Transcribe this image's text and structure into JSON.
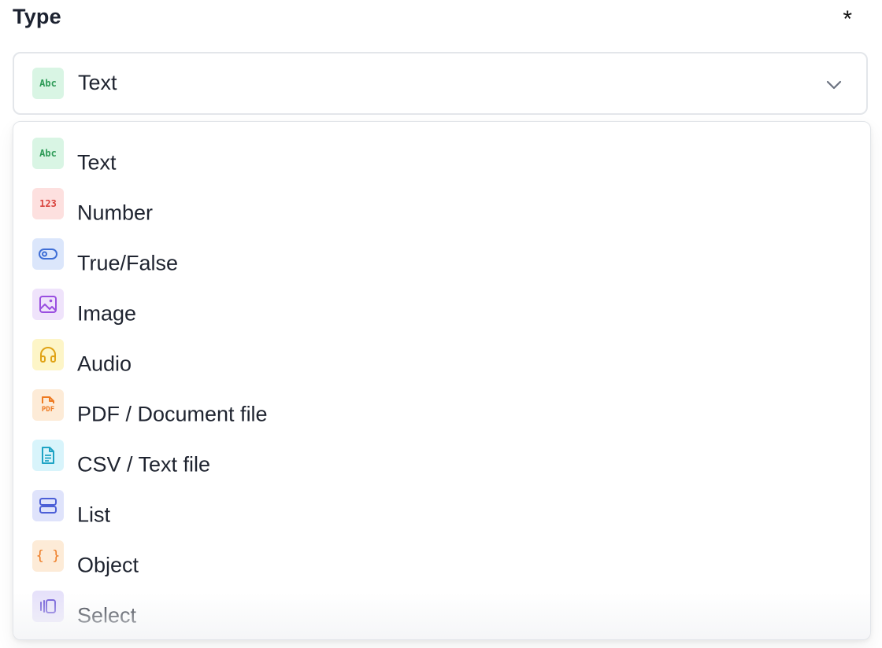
{
  "field": {
    "label": "Type",
    "required_mark": "*"
  },
  "select": {
    "selected_label": "Text",
    "selected_icon": "text-abc-icon",
    "selected_icon_text": "Abc"
  },
  "options": [
    {
      "label": "Text",
      "icon": "text-abc-icon",
      "icon_text": "Abc",
      "bg": "#d9f5e4",
      "fg": "#2e9b57"
    },
    {
      "label": "Number",
      "icon": "number-123-icon",
      "icon_text": "123",
      "bg": "#fde0df",
      "fg": "#d9443e"
    },
    {
      "label": "True/False",
      "icon": "toggle-icon",
      "bg": "#dbe6fb",
      "fg": "#3f6fd6"
    },
    {
      "label": "Image",
      "icon": "image-icon",
      "bg": "#efe3fb",
      "fg": "#9a4fe0"
    },
    {
      "label": "Audio",
      "icon": "headphones-icon",
      "bg": "#fdf5c7",
      "fg": "#e0a316"
    },
    {
      "label": "PDF / Document file",
      "icon": "pdf-file-icon",
      "icon_text": "PDF",
      "bg": "#fdebd7",
      "fg": "#ee7a21"
    },
    {
      "label": "CSV / Text file",
      "icon": "text-file-icon",
      "bg": "#d8f4fb",
      "fg": "#1ea3c4"
    },
    {
      "label": "List",
      "icon": "list-icon",
      "bg": "#dfe3fb",
      "fg": "#4c5fd7"
    },
    {
      "label": "Object",
      "icon": "braces-icon",
      "icon_text": "{ }",
      "bg": "#fdebd7",
      "fg": "#ee7a21"
    },
    {
      "label": "Select",
      "icon": "carousel-icon",
      "bg": "#e6e1fa",
      "fg": "#6a54d6"
    }
  ]
}
